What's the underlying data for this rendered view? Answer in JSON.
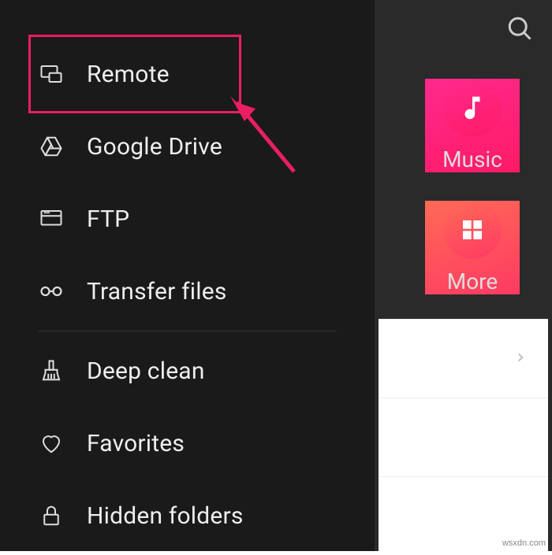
{
  "sidebar": {
    "items": [
      {
        "label": "Remote",
        "icon": "remote-icon"
      },
      {
        "label": "Google Drive",
        "icon": "google-drive-icon"
      },
      {
        "label": "FTP",
        "icon": "ftp-icon"
      },
      {
        "label": "Transfer files",
        "icon": "transfer-icon"
      },
      {
        "label": "Deep clean",
        "icon": "broom-icon"
      },
      {
        "label": "Favorites",
        "icon": "heart-icon"
      },
      {
        "label": "Hidden folders",
        "icon": "lock-icon"
      }
    ]
  },
  "categories": {
    "music": {
      "label": "Music"
    },
    "more": {
      "label": "More"
    }
  },
  "highlight": {
    "color": "#e91e63",
    "arrow_color": "#e91e63"
  },
  "watermark": "wsxdn.com"
}
